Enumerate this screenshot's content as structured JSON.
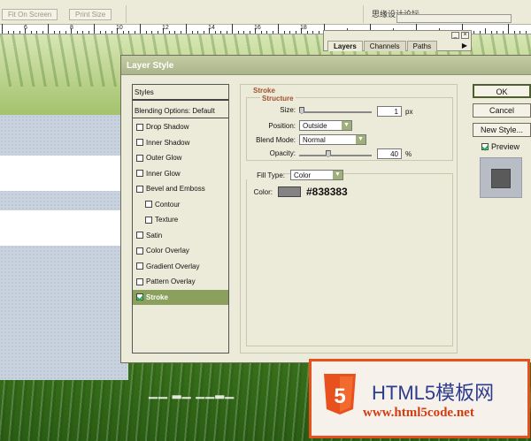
{
  "options_bar": {
    "fit_on_screen": "Fit On Screen",
    "print_size": "Print Size",
    "corner_text": "思缘设计论坛"
  },
  "ruler": {
    "numbers": [
      "6",
      "8",
      "10",
      "12",
      "14",
      "16",
      "18"
    ]
  },
  "layers_palette": {
    "tabs": [
      "Layers",
      "Channels",
      "Paths"
    ]
  },
  "dialog": {
    "title": "Layer Style",
    "style_list": {
      "header": "Styles",
      "blending": "Blending Options: Default",
      "items": [
        {
          "label": "Drop Shadow",
          "checked": false
        },
        {
          "label": "Inner Shadow",
          "checked": false
        },
        {
          "label": "Outer Glow",
          "checked": false
        },
        {
          "label": "Inner Glow",
          "checked": false
        },
        {
          "label": "Bevel and Emboss",
          "checked": false
        },
        {
          "label": "Contour",
          "checked": false
        },
        {
          "label": "Texture",
          "checked": false
        },
        {
          "label": "Satin",
          "checked": false
        },
        {
          "label": "Color Overlay",
          "checked": false
        },
        {
          "label": "Gradient Overlay",
          "checked": false
        },
        {
          "label": "Pattern Overlay",
          "checked": false
        },
        {
          "label": "Stroke",
          "checked": true
        }
      ]
    },
    "stroke": {
      "title": "Stroke",
      "structure_title": "Structure",
      "size_label": "Size:",
      "size_value": "1",
      "size_unit": "px",
      "position_label": "Position:",
      "position_value": "Outside",
      "blend_mode_label": "Blend Mode:",
      "blend_mode_value": "Normal",
      "opacity_label": "Opacity:",
      "opacity_value": "40",
      "opacity_unit": "%",
      "fill_type_label": "Fill Type:",
      "fill_type_value": "Color",
      "color_label": "Color:",
      "color_hex": "#838383"
    },
    "buttons": {
      "ok": "OK",
      "cancel": "Cancel",
      "new_style": "New Style...",
      "preview": "Preview"
    }
  },
  "watermark": {
    "line1": "HTML5模板网",
    "line2": "www.html5code.net"
  },
  "colors": {
    "stroke_color": "#838383",
    "accent": "#8aa05c",
    "watermark_orange": "#e8501e"
  }
}
